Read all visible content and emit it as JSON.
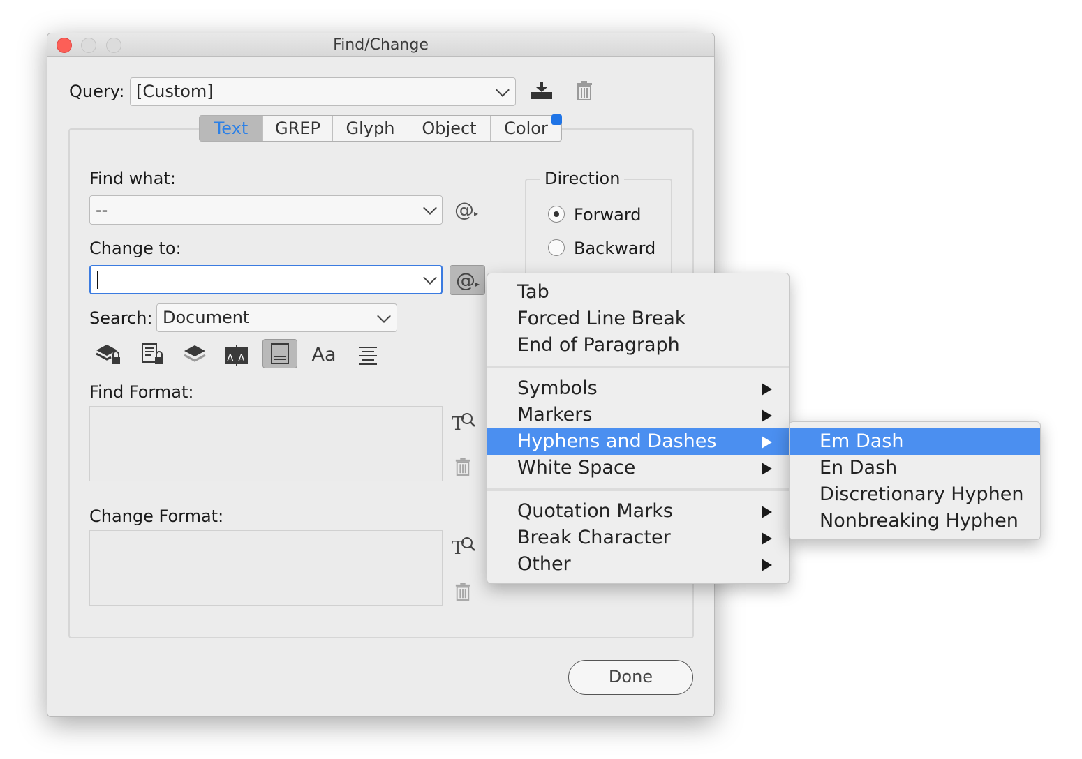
{
  "window": {
    "title": "Find/Change"
  },
  "query": {
    "label": "Query:",
    "value": "[Custom]",
    "save_icon": "save-query-icon",
    "delete_icon": "trash-icon"
  },
  "tabs": [
    {
      "label": "Text",
      "active": true
    },
    {
      "label": "GREP",
      "active": false
    },
    {
      "label": "Glyph",
      "active": false
    },
    {
      "label": "Object",
      "active": false
    },
    {
      "label": "Color",
      "active": false
    }
  ],
  "find_what": {
    "label": "Find what:",
    "value": "--"
  },
  "change_to": {
    "label": "Change to:",
    "value": ""
  },
  "search": {
    "label": "Search:",
    "value": "Document"
  },
  "direction": {
    "label": "Direction",
    "forward": "Forward",
    "backward": "Backward",
    "selected": "Forward"
  },
  "options_toolbar": {
    "icons": [
      "include-locked-layers-icon",
      "include-locked-stories-icon",
      "include-hidden-layers-icon",
      "include-master-pages-icon",
      "include-footnotes-icon",
      "case-sensitive-icon",
      "whole-word-icon"
    ],
    "case_label": "Aa",
    "pressed": "include-footnotes-icon"
  },
  "find_format": {
    "label": "Find Format:"
  },
  "change_format": {
    "label": "Change Format:"
  },
  "done": "Done",
  "special_menu": {
    "group1": [
      "Tab",
      "Forced Line Break",
      "End of Paragraph"
    ],
    "group2": [
      "Symbols",
      "Markers",
      "Hyphens and Dashes",
      "White Space"
    ],
    "group3": [
      "Quotation Marks",
      "Break Character",
      "Other"
    ],
    "highlighted": "Hyphens and Dashes"
  },
  "submenu": {
    "items": [
      "Em Dash",
      "En Dash",
      "Discretionary Hyphen",
      "Nonbreaking Hyphen"
    ],
    "highlighted": "Em Dash"
  },
  "colors": {
    "accent": "#4b8ff0",
    "active_tab_text": "#2c80e6",
    "close_button": "#fc5f57"
  }
}
